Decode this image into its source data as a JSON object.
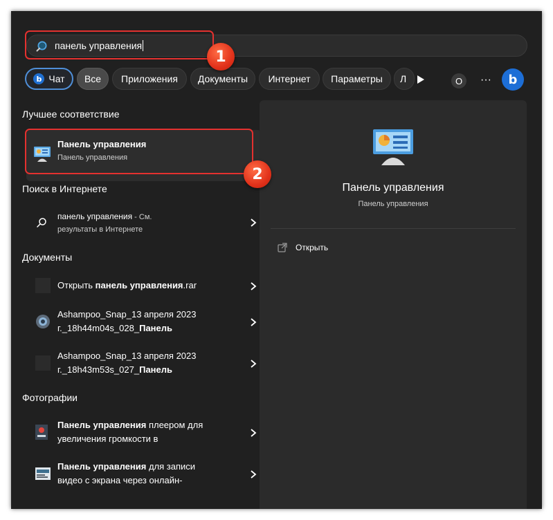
{
  "search": {
    "value": "панель управления"
  },
  "annotations": {
    "badge1": "1",
    "badge2": "2"
  },
  "filters": {
    "chat": "Чат",
    "all": "Все",
    "apps": "Приложения",
    "documents": "Документы",
    "internet": "Интернет",
    "settings": "Параметры",
    "more_cut": "Л",
    "profile_initial": "O",
    "more_dots": "···"
  },
  "sections": {
    "best_match": "Лучшее соответствие",
    "web": "Поиск в Интернете",
    "docs": "Документы",
    "photos": "Фотографии"
  },
  "best_match": {
    "title": "Панель управления",
    "subtitle": "Панель управления"
  },
  "web_result": {
    "query": "панель управления",
    "suffix": " - См.",
    "line2": "результаты в Интернете"
  },
  "documents": [
    {
      "prefix": "Открыть ",
      "bold": "панель управления",
      "suffix": ".rar",
      "line2_prefix": "",
      "line2_bold": ""
    },
    {
      "prefix": "Ashampoo_Snap_13 апреля 2023",
      "bold": "",
      "suffix": "",
      "line2_prefix": "г._18h44m04s_028_",
      "line2_bold": "Панель"
    },
    {
      "prefix": "Ashampoo_Snap_13 апреля 2023",
      "bold": "",
      "suffix": "",
      "line2_prefix": "г._18h43m53s_027_",
      "line2_bold": "Панель"
    }
  ],
  "photos": [
    {
      "bold": "Панель управления",
      "rest": " плеером для",
      "line2": "увеличения громкости в"
    },
    {
      "bold": "Панель управления",
      "rest": " для записи",
      "line2": "видео с экрана через онлайн-"
    }
  ],
  "preview": {
    "title": "Панель управления",
    "subtitle": "Панель управления",
    "action": "Открыть"
  },
  "colors": {
    "highlight": "#e5312f",
    "accent": "#4f8fd8",
    "background": "#202020"
  },
  "icons": [
    "search-icon",
    "bing-icon",
    "play-icon",
    "more-icon",
    "control-panel-icon",
    "chevron-right-icon",
    "open-external-icon",
    "document-icon",
    "photo-icon"
  ]
}
